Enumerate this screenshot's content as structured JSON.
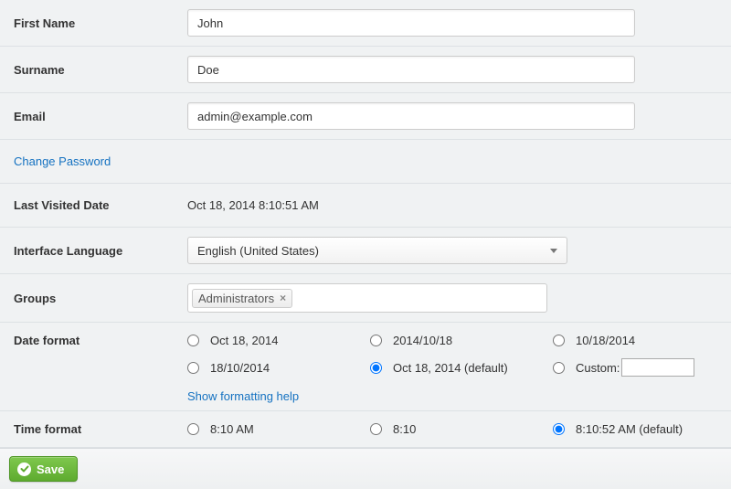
{
  "fields": {
    "first_name": {
      "label": "First Name",
      "value": "John"
    },
    "surname": {
      "label": "Surname",
      "value": "Doe"
    },
    "email": {
      "label": "Email",
      "value": "admin@example.com"
    },
    "change_password": "Change Password",
    "last_visited": {
      "label": "Last Visited Date",
      "value": "Oct 18, 2014 8:10:51 AM"
    },
    "language": {
      "label": "Interface Language",
      "value": "English (United States)"
    },
    "groups": {
      "label": "Groups",
      "tag": "Administrators"
    }
  },
  "date_format": {
    "label": "Date format",
    "options": {
      "o1": "Oct 18, 2014",
      "o2": "2014/10/18",
      "o3": "10/18/2014",
      "o4": "18/10/2014",
      "o5": "Oct 18, 2014 (default)",
      "o6": "Custom:"
    },
    "selected": "o5",
    "help": "Show formatting help"
  },
  "time_format": {
    "label": "Time format",
    "options": {
      "t1": "8:10 AM",
      "t2": "8:10",
      "t3": "8:10:52 AM (default)"
    },
    "selected": "t3"
  },
  "footer": {
    "save": "Save"
  }
}
